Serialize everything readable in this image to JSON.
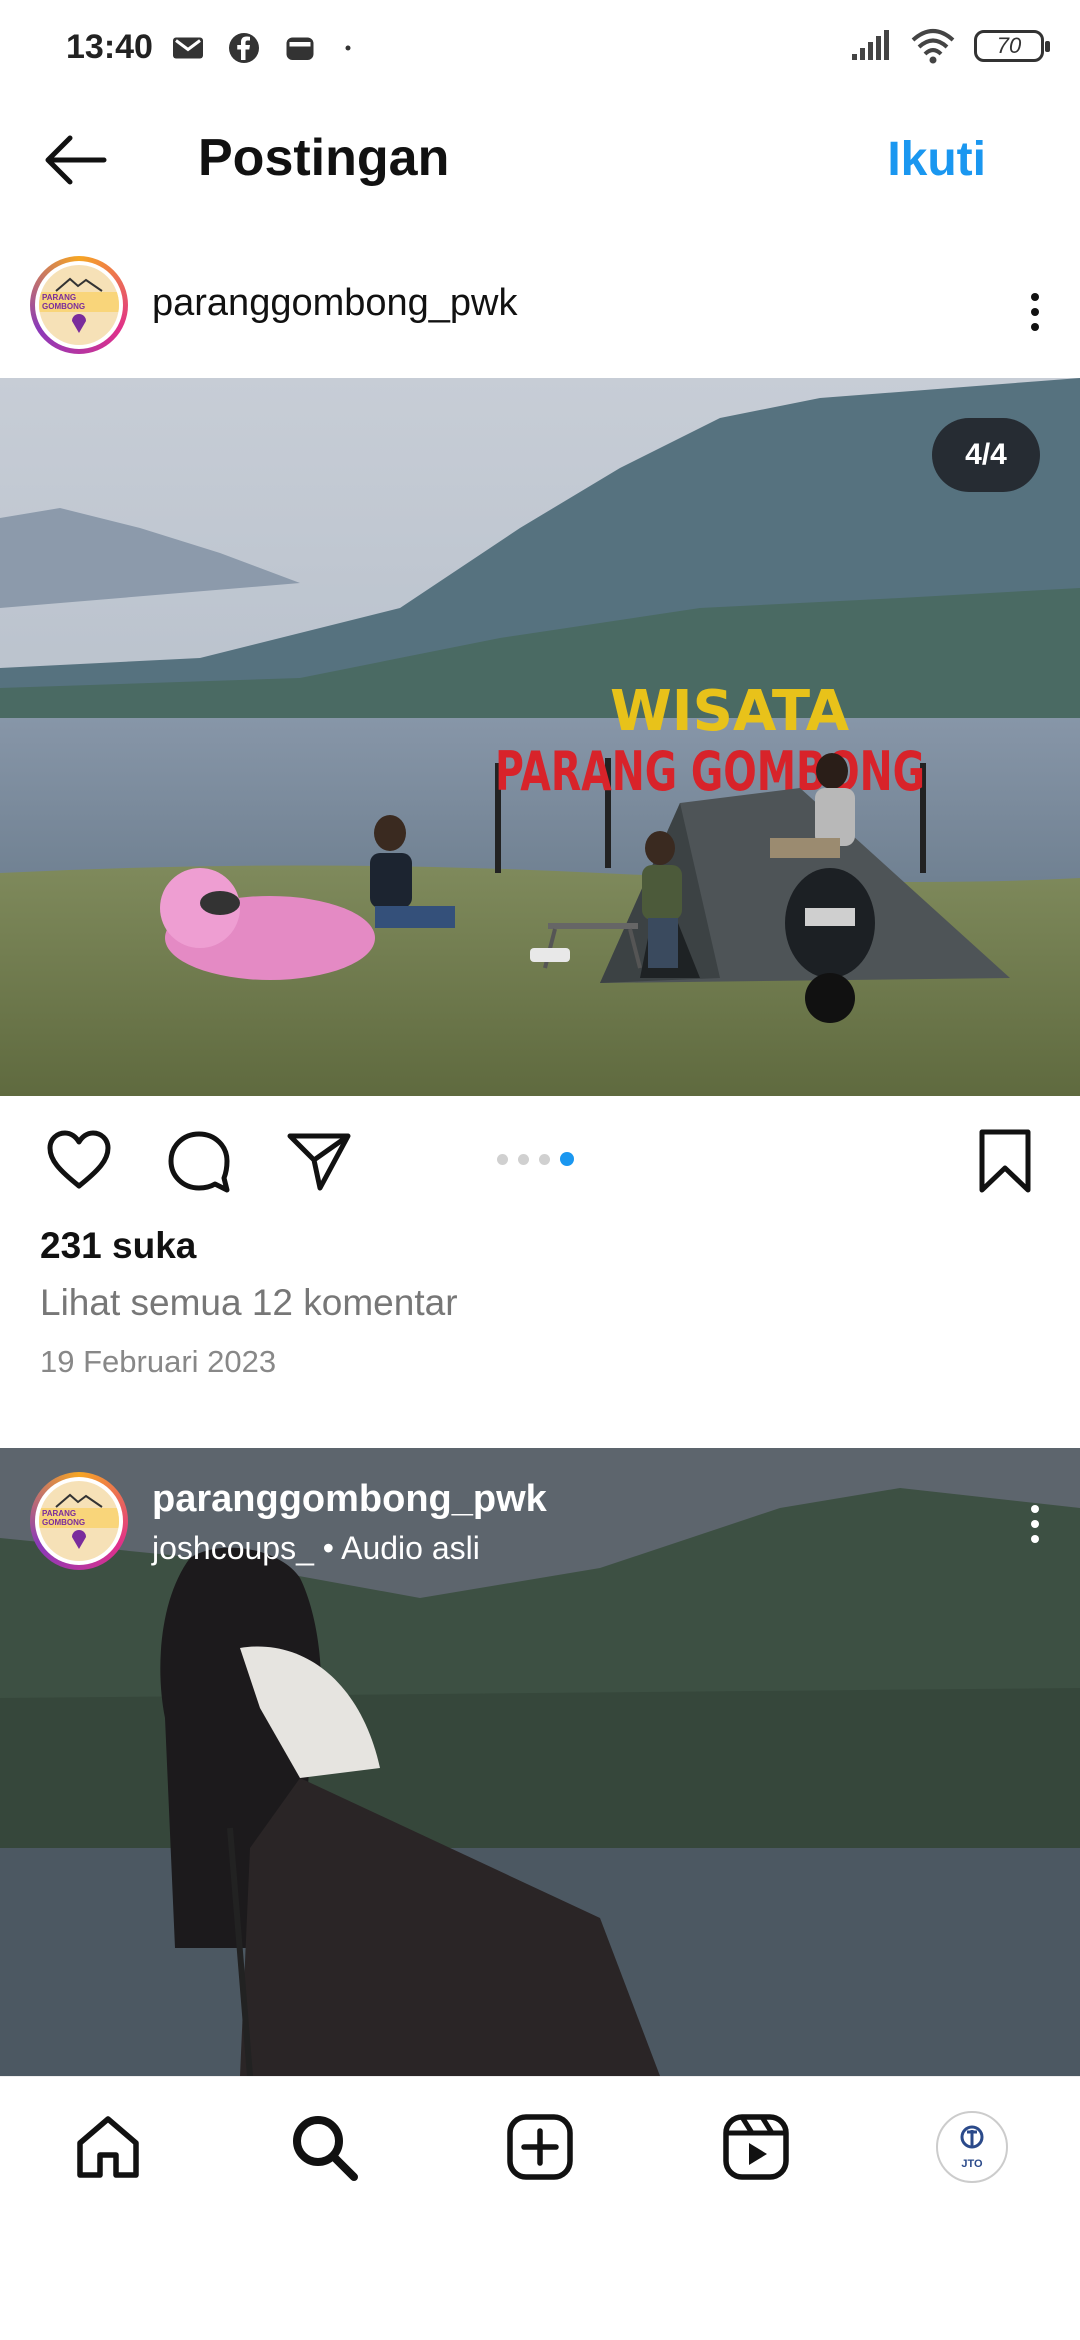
{
  "status_bar": {
    "time": "13:40",
    "left_icons": [
      "gmail-icon",
      "facebook-icon",
      "wallet-icon",
      "dot-icon"
    ],
    "battery": "70"
  },
  "header": {
    "title": "Postingan",
    "follow_label": "Ikuti",
    "back_icon": "arrow-left-icon"
  },
  "post": {
    "username": "paranggombong_pwk",
    "avatar_label": "PARANG GOMBONG",
    "image_counter": "4/4",
    "sign_top": "WISATA",
    "sign_bottom": "PARANG GOMBONG",
    "carousel": {
      "count": 4,
      "active": 4
    },
    "likes": "231 suka",
    "comments_link": "Lihat semua 12 komentar",
    "date": "19 Februari 2023",
    "actions": [
      "heart-icon",
      "comment-icon",
      "share-icon",
      "bookmark-icon"
    ]
  },
  "reel": {
    "username": "paranggombong_pwk",
    "subtitle": "joshcoups_ • Audio asli"
  },
  "bottom_nav": {
    "items": [
      "home-icon",
      "search-icon",
      "create-icon",
      "reels-icon",
      "profile-avatar"
    ],
    "profile_label": "JTO"
  },
  "colors": {
    "accent": "#1a97f0",
    "counter_bg": "#262c33",
    "sign_yellow": "#e8c21a",
    "sign_red": "#d8232a"
  }
}
